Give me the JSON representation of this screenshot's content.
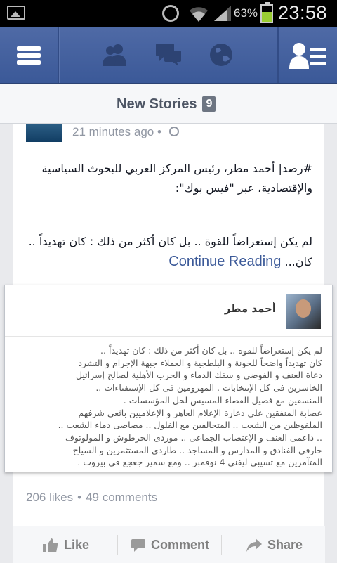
{
  "status_bar": {
    "battery_percent": "63%",
    "time": "23:58",
    "icons": [
      "image-notification-icon",
      "alarm-icon",
      "wifi-icon",
      "signal-icon",
      "battery-icon"
    ]
  },
  "header": {
    "icons": [
      "menu-icon",
      "friend-requests-icon",
      "messages-icon",
      "notifications-globe-icon",
      "friends-list-icon"
    ],
    "color": "#3b5998"
  },
  "new_stories": {
    "label": "New Stories",
    "count": "9"
  },
  "story": {
    "timestamp": "21 minutes ago •",
    "text_line1": "#رصد| أحمد مطر، رئيس المركز العربي للبحوث السياسية",
    "text_line2": "والإقتصادية، عبر \"فيس بوك\":",
    "text_line3": "لم يكن إستعراضاً للقوة .. بل كان أكثر من ذلك : كان تهديداً ..",
    "text_line4_tail": "كان...",
    "continue_label": "Continue Reading",
    "preview": {
      "author": "أحمد مطر",
      "lines": [
        "لم يكن إستعراضاً للقوة .. بل كان أكثر من ذلك : كان تهديداً ..",
        "كان تهديداً واضحاً للخونة و البلطجية و العملاء جبهة الإجرام و التشرد",
        "دعاة العنف و الفوضى و سفك الدماء و الحرب الأهلية لصالح إسرائيل",
        "الخاسرين فى كل الإنتخابات . المهزومين فى كل الإستفتاءات ..",
        "المنسقين مع فصيل القضاء المسيس لحل المؤسسات .",
        "عصابة المنفقين على دعارة الإعلام العاهر و الإعلاميين باثعى شرفهم",
        "الملفوظين من الشعب .. المتحالفين مع الفلول .. مصاصى دماء الشعب ..",
        ".. داعمى العنف و الإغتصاب الجماعى .. موردى الخرطوش و المولوتوف",
        "حارقى الفنادق و المدارس و المساجد .. طاردى المستثمرين و السياح",
        "المتآمرين مع تسيبى ليفنى 4 نوفمبر .. ومع سمير جعجع فى بيروت ."
      ]
    },
    "likes": "206 likes",
    "comments": "49 comments",
    "actions": {
      "like": "Like",
      "comment": "Comment",
      "share": "Share"
    }
  }
}
